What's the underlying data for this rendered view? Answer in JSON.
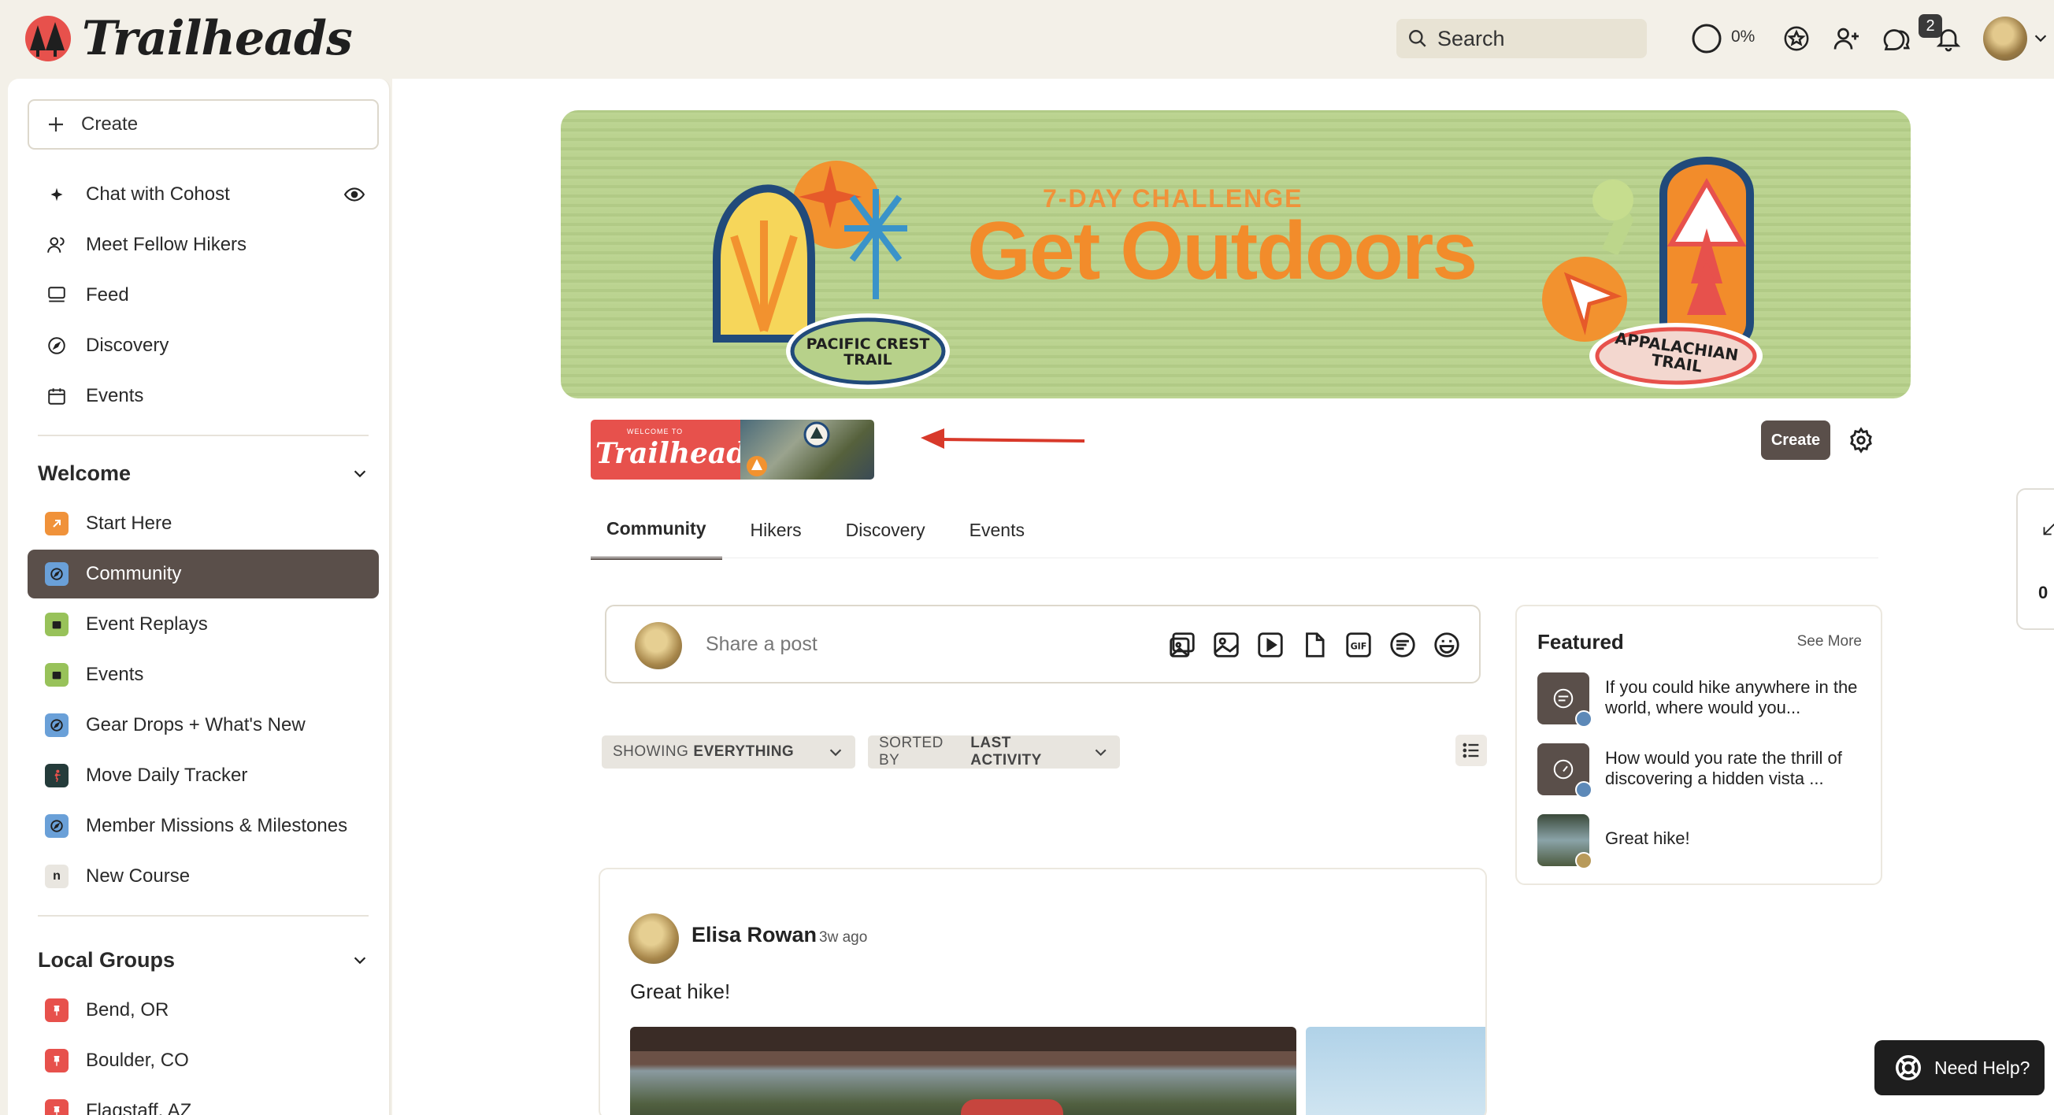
{
  "app": {
    "name": "Trailheads"
  },
  "topbar": {
    "search_placeholder": "Search",
    "progress_label": "0%",
    "progress_value": 0,
    "notifications_count": "2"
  },
  "sidebar": {
    "create_label": "Create",
    "primary_items": [
      {
        "label": "Chat with Cohost",
        "icon": "sparkle-icon"
      },
      {
        "label": "Meet Fellow Hikers",
        "icon": "people-icon"
      },
      {
        "label": "Feed",
        "icon": "feed-icon"
      },
      {
        "label": "Discovery",
        "icon": "compass-icon"
      },
      {
        "label": "Events",
        "icon": "calendar-icon"
      }
    ],
    "welcome": {
      "title": "Welcome",
      "items": [
        {
          "label": "Start Here",
          "icon": "arrow-up-right-icon",
          "color": "#f0923a"
        },
        {
          "label": "Community",
          "icon": "compass-icon",
          "color": "#6aa0d8",
          "active": true
        },
        {
          "label": "Event Replays",
          "icon": "calendar-icon",
          "color": "#98c25a"
        },
        {
          "label": "Events",
          "icon": "calendar-icon",
          "color": "#98c25a"
        },
        {
          "label": "Gear Drops + What's New",
          "icon": "compass-icon",
          "color": "#6aa0d8"
        },
        {
          "label": "Move Daily Tracker",
          "icon": "runner-icon",
          "color": "#243b3a"
        },
        {
          "label": "Member Missions & Milestones",
          "icon": "compass-icon",
          "color": "#6aa0d8"
        },
        {
          "label": "New Course",
          "icon": "course-n-icon",
          "color": "#e9e6e0"
        }
      ]
    },
    "local_groups": {
      "title": "Local Groups",
      "items": [
        {
          "label": "Bend, OR",
          "icon": "pin-icon",
          "color": "#e7514c"
        },
        {
          "label": "Boulder, CO",
          "icon": "pin-icon",
          "color": "#e7514c"
        },
        {
          "label": "Flagstaff, AZ",
          "icon": "pin-icon",
          "color": "#e7514c"
        }
      ]
    }
  },
  "banner": {
    "kicker": "7-DAY CHALLENGE",
    "headline": "Get Outdoors",
    "badge_left": "PACIFIC CREST TRAIL",
    "badge_right": "APPALACHIAN TRAIL"
  },
  "space_header": {
    "thumb_welcome": "WELCOME TO",
    "thumb_logo": "Trailheads",
    "create_label": "Create"
  },
  "tabs": [
    {
      "label": "Community",
      "active": true
    },
    {
      "label": "Hikers"
    },
    {
      "label": "Discovery"
    },
    {
      "label": "Events"
    }
  ],
  "composer": {
    "placeholder": "Share a post",
    "icons": [
      "gallery-icon",
      "image-icon",
      "video-icon",
      "file-icon",
      "gif-icon",
      "poll-icon",
      "emoji-icon"
    ]
  },
  "filters": {
    "showing_prefix": "SHOWING",
    "showing_value": "EVERYTHING",
    "sorted_prefix": "SORTED BY",
    "sorted_value": "LAST ACTIVITY"
  },
  "post": {
    "author": "Elisa Rowan",
    "time": "3w ago",
    "body": "Great hike!"
  },
  "featured": {
    "title": "Featured",
    "see_more": "See More",
    "items": [
      {
        "text": "If you could hike anywhere in the world, where would you..."
      },
      {
        "text": "How would you rate the thrill of discovering a hidden vista ..."
      },
      {
        "text": "Great hike!"
      }
    ]
  },
  "side_tab": {
    "count": "0"
  },
  "help": {
    "label": "Need Help?"
  },
  "colors": {
    "accent_dark": "#5a4f4a",
    "brand_orange": "#f28c2b",
    "banner_green": "#b7d18a",
    "brand_red": "#e7514c"
  }
}
